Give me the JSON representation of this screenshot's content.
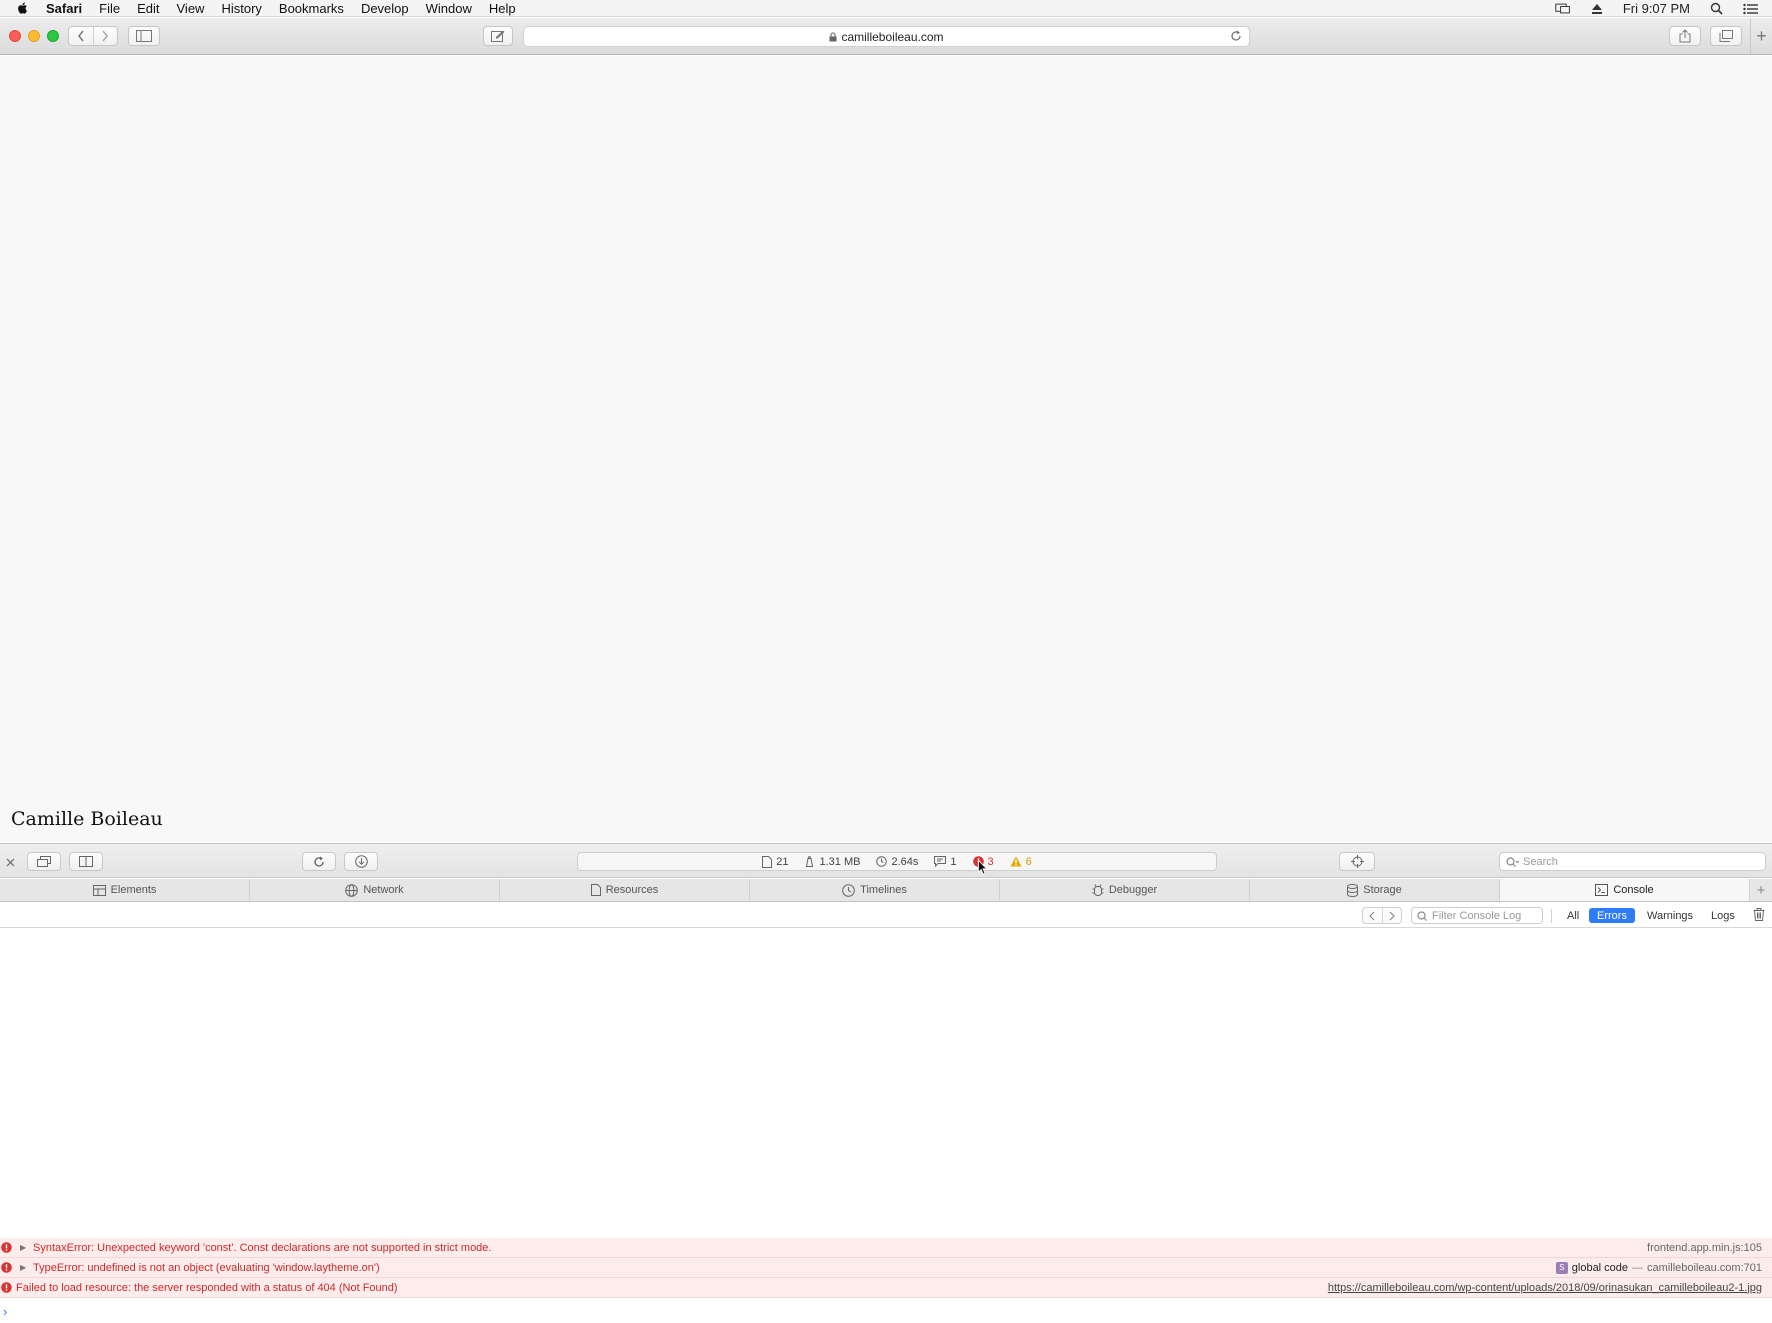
{
  "menubar": {
    "app_name": "Safari",
    "menus": [
      "File",
      "Edit",
      "View",
      "History",
      "Bookmarks",
      "Develop",
      "Window",
      "Help"
    ],
    "clock": "Fri 9:07 PM"
  },
  "toolbar": {
    "url": "camilleboileau.com"
  },
  "page": {
    "site_title": "Camille Boileau"
  },
  "inspector": {
    "dashboard": {
      "resources": "21",
      "size": "1.31 MB",
      "load_time": "2.64s",
      "logs": "1",
      "errors": "3",
      "warnings": "6"
    },
    "search_placeholder": "Search",
    "tabs": [
      {
        "label": "Elements",
        "icon": "elements-icon"
      },
      {
        "label": "Network",
        "icon": "network-icon"
      },
      {
        "label": "Resources",
        "icon": "resources-icon"
      },
      {
        "label": "Timelines",
        "icon": "timelines-icon"
      },
      {
        "label": "Debugger",
        "icon": "debugger-icon"
      },
      {
        "label": "Storage",
        "icon": "storage-icon"
      },
      {
        "label": "Console",
        "icon": "console-icon"
      }
    ],
    "active_tab": "Console"
  },
  "console": {
    "filter_placeholder": "Filter Console Log",
    "levels": {
      "all": "All",
      "errors": "Errors",
      "warnings": "Warnings",
      "logs": "Logs"
    },
    "active_level": "Errors",
    "messages": [
      {
        "text": "SyntaxError: Unexpected keyword 'const'. Const declarations are not supported in strict mode.",
        "source": "frontend.app.min.js:105"
      },
      {
        "text": "TypeError: undefined is not an object (evaluating 'window.laytheme.on')",
        "badge": "S",
        "scope": "global code",
        "dash": "—",
        "source": "camilleboileau.com:701"
      },
      {
        "text": "Failed to load resource: the server responded with a status of 404 (Not Found)",
        "source": "https://camilleboileau.com/wp-content/uploads/2018/09/orinasukan_camilleboileau2-1.jpg"
      }
    ],
    "prompt": "›"
  },
  "colors": {
    "error": "#cc2b2b",
    "error_bg": "#fdecec",
    "accent": "#2e7cf6",
    "warning": "#d6a000"
  }
}
